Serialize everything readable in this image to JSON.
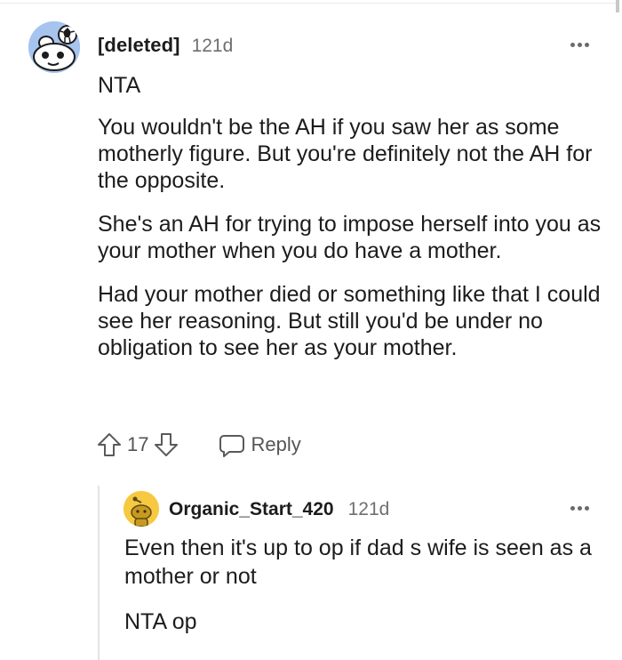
{
  "comment": {
    "author": "[deleted]",
    "age": "121d",
    "paragraphs": [
      "NTA",
      "You wouldn't be the AH if you saw her as some motherly figure. But you're definitely not the AH for the opposite.",
      "She's an AH for trying to impose herself into you as your mother when you do have a mother.",
      "Had your mother died or something like that I could see her reasoning. But still you'd be under no obligation to see her as your mother."
    ],
    "score": "17",
    "reply_label": "Reply",
    "avatar_icon": "snoo-avatar-icon",
    "avatar_color": "#a7c4ef"
  },
  "reply": {
    "author": "Organic_Start_420",
    "age": "121d",
    "paragraphs": [
      "Even then it's up to op if dad s wife is seen as a mother or not",
      "NTA op"
    ],
    "avatar_icon": "snoo-avatar-icon",
    "avatar_color": "#f6c940"
  },
  "icons": {
    "upvote": "upvote-arrow-icon",
    "downvote": "downvote-arrow-icon",
    "reply": "speech-bubble-icon",
    "more": "ellipsis-icon"
  }
}
